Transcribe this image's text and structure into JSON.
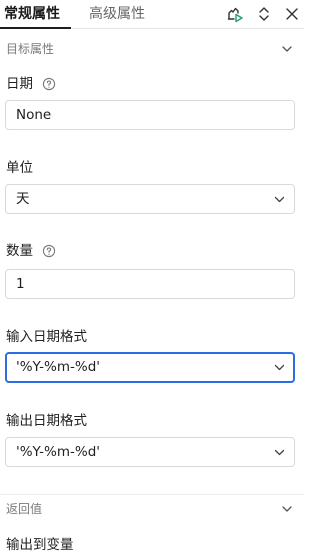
{
  "header": {
    "tabs": [
      {
        "label": "常规属性",
        "active": true
      },
      {
        "label": "高级属性",
        "active": false
      }
    ],
    "icons": [
      "run-icon",
      "expand-collapse-icon",
      "close-icon"
    ],
    "accent_color": "#22a06b"
  },
  "sections": {
    "target": {
      "title": "目标属性",
      "icon": "chevron-down-icon"
    },
    "return": {
      "title": "返回值",
      "icon": "chevron-down-icon"
    }
  },
  "fields": {
    "date": {
      "label": "日期",
      "value": "None",
      "help_icon": "help-circle-icon"
    },
    "unit": {
      "label": "单位",
      "value": "天",
      "icon": "chevron-down-icon"
    },
    "quantity": {
      "label": "数量",
      "value": "1",
      "help_icon": "help-circle-icon"
    },
    "input_format": {
      "label": "输入日期格式",
      "value": "'%Y-%m-%d'",
      "icon": "chevron-down-icon",
      "focused": true
    },
    "output_format": {
      "label": "输出日期格式",
      "value": "'%Y-%m-%d'",
      "icon": "chevron-down-icon"
    }
  },
  "return_value": {
    "label": "输出到变量"
  },
  "colors": {
    "focus_border": "#2b6de5",
    "border": "#d9d9d9"
  }
}
